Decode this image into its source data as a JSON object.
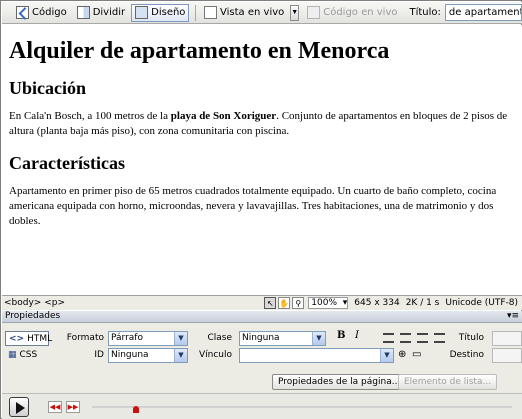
{
  "toolbar": {
    "code_label": "Código",
    "split_label": "Dividir",
    "design_label": "Diseño",
    "live_view_label": "Vista en vivo",
    "live_code_label": "Código en vivo",
    "title_label": "Título:",
    "title_value": "de apartamento en Menorca",
    "active_view": "Diseño"
  },
  "document": {
    "h1": "Alquiler de apartamento en Menorca",
    "section1_heading": "Ubicación",
    "section1_text_before": "En Cala'n Bosch, a 100 metros de la ",
    "section1_bold": "playa de Son Xoriguer",
    "section1_text_after": ". Conjunto de apartamentos en bloques de 2 pisos de altura (planta baja más piso), con zona comunitaria con piscina.",
    "section2_heading": "Características",
    "section2_text": "Apartamento en primer piso de 65 metros cuadrados totalmente equipado. Un cuarto de baño completo, cocina americana equipada con horno, microondas, nevera y lavavajillas. Tres habitaciones, una de matrimonio y dos dobles."
  },
  "status_bar": {
    "tag_path": "<body> <p>",
    "zoom": "100%",
    "dimensions": "645 x 334",
    "download": "2K / 1 s",
    "encoding": "Unicode (UTF-8)"
  },
  "properties": {
    "panel_title": "Propiedades",
    "html_mode": "HTML",
    "css_mode": "CSS",
    "format_label": "Formato",
    "format_value": "Párrafo",
    "id_label": "ID",
    "id_value": "Ninguna",
    "class_label": "Clase",
    "class_value": "Ninguna",
    "link_label": "Vínculo",
    "link_value": "",
    "bold_label": "B",
    "italic_label": "I",
    "title_label": "Título",
    "target_label": "Destino",
    "page_props_button": "Propiedades de la página...",
    "list_item_button": "Elemento de lista..."
  },
  "colors": {
    "accent": "#7d96c0",
    "record_red": "#cc1010"
  }
}
